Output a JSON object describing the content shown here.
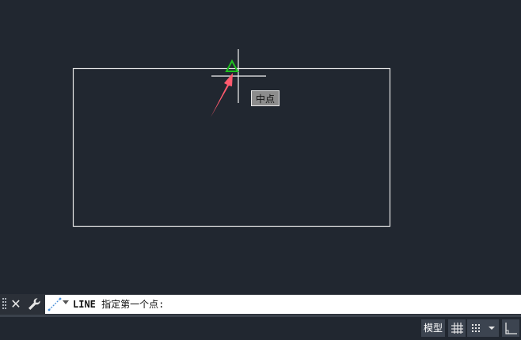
{
  "canvas": {
    "background": "#212730",
    "snap_tooltip": "中点",
    "snap_marker_color": "#1fc01f",
    "arrow_color": "#ff5a6e"
  },
  "command_line": {
    "command": "LINE",
    "prompt": "指定第一个点:"
  },
  "status_bar": {
    "model_tab": "模型",
    "buttons": [
      "grid-icon",
      "snap-icon",
      "dropdown-icon",
      "ortho-icon"
    ]
  }
}
